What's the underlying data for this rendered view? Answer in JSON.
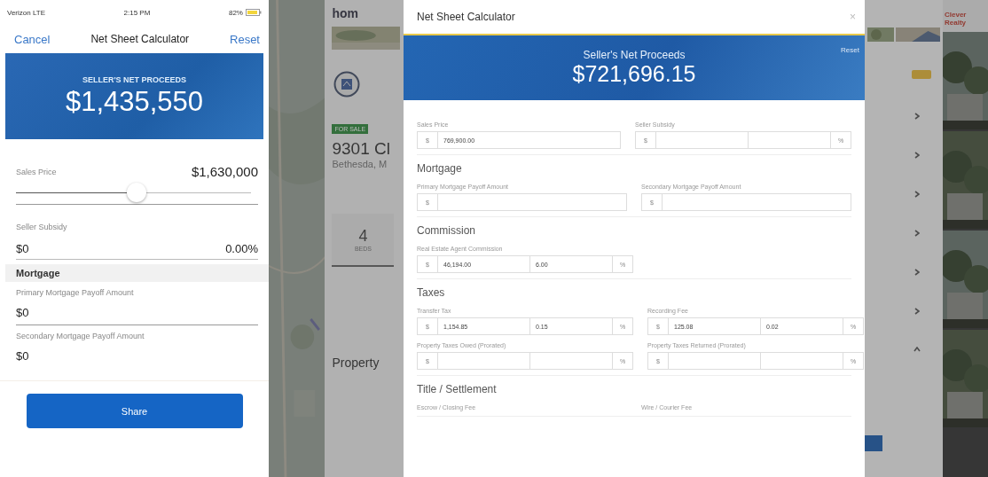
{
  "phone": {
    "status_bar": {
      "carrier": "Verizon LTE",
      "time": "2:15 PM",
      "battery": "82%"
    },
    "nav": {
      "cancel": "Cancel",
      "title": "Net Sheet Calculator",
      "reset": "Reset"
    },
    "banner": {
      "label": "SELLER'S NET PROCEEDS",
      "value": "$1,435,550"
    },
    "sales_price": {
      "label": "Sales Price",
      "value": "$1,630,000",
      "level": 0.5
    },
    "seller_subsidy": {
      "label": "Seller Subsidy",
      "amount": "$0",
      "percent": "0.00%"
    },
    "section": "Mortgage",
    "fields": [
      {
        "label": "Primary Mortgage Payoff Amount",
        "value": "$0"
      },
      {
        "label": "Secondary Mortgage Payoff Amount",
        "value": "$0"
      }
    ],
    "share_button": "Share"
  },
  "background_page": {
    "logo": "hom",
    "badge": "FOR SALE",
    "address": "9301 Cl",
    "city": "Bethesda, M",
    "beds": "4",
    "beds_label": "BEDS",
    "section": "Property",
    "brand": "Clever Realty"
  },
  "modal": {
    "title": "Net Sheet Calculator",
    "close": "×",
    "banner": {
      "label": "Seller's Net Proceeds",
      "value": "$721,696.15",
      "reset": "Reset"
    },
    "groups": [
      {
        "fields": [
          {
            "kind": "amount",
            "label": "Sales Price",
            "prefix": "$",
            "value": "769,900.00"
          },
          {
            "kind": "split",
            "label": "Seller Subsidy",
            "prefix": "$",
            "suffix": "%"
          }
        ]
      },
      {
        "heading": "Mortgage",
        "fields": [
          {
            "kind": "amount",
            "label": "Primary Mortgage Payoff Amount",
            "prefix": "$"
          },
          {
            "kind": "amount",
            "label": "Secondary Mortgage Payoff Amount",
            "prefix": "$"
          }
        ]
      },
      {
        "heading": "Commission",
        "fields": [
          {
            "kind": "split",
            "label": "Real Estate Agent Commission",
            "prefix": "$",
            "value": "46,194.00",
            "percent": "6.00",
            "suffix": "%"
          }
        ]
      },
      {
        "heading": "Taxes",
        "fields": [
          {
            "kind": "split",
            "label": "Transfer Tax",
            "prefix": "$",
            "value": "1,154.85",
            "percent": "0.15",
            "suffix": "%"
          },
          {
            "kind": "split",
            "label": "Recording Fee",
            "prefix": "$",
            "value": "125.08",
            "percent": "0.02",
            "suffix": "%"
          },
          {
            "kind": "split",
            "label": "Property Taxes Owed (Prorated)",
            "prefix": "$",
            "suffix": "%"
          },
          {
            "kind": "split",
            "label": "Property Taxes Returned (Prorated)",
            "prefix": "$",
            "suffix": "%"
          }
        ]
      },
      {
        "heading": "Title / Settlement",
        "fields": [
          {
            "kind": "label",
            "label": "Escrow / Closing Fee"
          },
          {
            "kind": "label",
            "label": "Wire / Courier Fee"
          }
        ]
      }
    ]
  }
}
